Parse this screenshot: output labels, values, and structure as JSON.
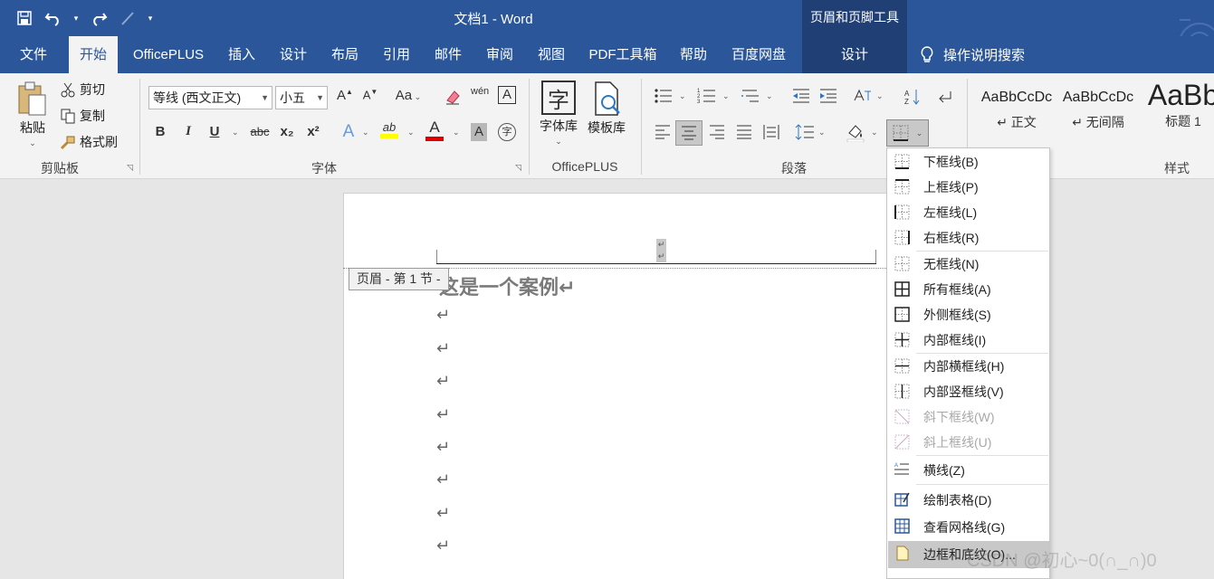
{
  "qat": {
    "save_icon": "save-icon",
    "undo_icon": "undo-icon",
    "redo_icon": "redo-icon",
    "pen_icon": "pen-icon"
  },
  "window": {
    "title": "文档1  -  Word",
    "context_title": "页眉和页脚工具"
  },
  "tabs": [
    {
      "label": "文件"
    },
    {
      "label": "开始"
    },
    {
      "label": "OfficePLUS"
    },
    {
      "label": "插入"
    },
    {
      "label": "设计"
    },
    {
      "label": "布局"
    },
    {
      "label": "引用"
    },
    {
      "label": "邮件"
    },
    {
      "label": "审阅"
    },
    {
      "label": "视图"
    },
    {
      "label": "PDF工具箱"
    },
    {
      "label": "帮助"
    },
    {
      "label": "百度网盘"
    },
    {
      "label": "设计"
    }
  ],
  "tellme": {
    "label": "操作说明搜索"
  },
  "clipboard": {
    "paste": "粘贴",
    "cut": "剪切",
    "copy": "复制",
    "format_painter": "格式刷",
    "label": "剪贴板"
  },
  "font": {
    "name": "等线 (西文正文)",
    "size": "小五",
    "label": "字体",
    "bold": "B",
    "italic": "I",
    "underline": "U",
    "strike": "abc",
    "sub": "x₂",
    "sup": "x²",
    "aa": "Aa",
    "grow": "A",
    "shrink": "A",
    "effects": "A",
    "highlight": "ab",
    "color": "A",
    "shade": "A",
    "enclose": "字",
    "phonetic": "wén",
    "border": "A",
    "highlight_color": "#ffff00",
    "font_color": "#e00000"
  },
  "officeplus": {
    "font_lib": "字体库",
    "template_lib": "模板库",
    "label": "OfficePLUS",
    "font_glyph": "字"
  },
  "paragraph": {
    "label": "段落"
  },
  "styles": {
    "label": "样式",
    "items": [
      {
        "preview": "AaBbCcDc",
        "name": "↵ 正文"
      },
      {
        "preview": "AaBbCcDc",
        "name": "↵ 无间隔"
      },
      {
        "preview": "AaBb",
        "name": "标题 1"
      }
    ]
  },
  "document": {
    "header_tag": "页眉 - 第 1 节 -",
    "title": "这是一个案例↵",
    "para_mark": "↵"
  },
  "border_menu": {
    "items": [
      {
        "label": "下框线(B)",
        "icon": "bottom-border-icon",
        "disabled": false
      },
      {
        "label": "上框线(P)",
        "icon": "top-border-icon",
        "disabled": false
      },
      {
        "label": "左框线(L)",
        "icon": "left-border-icon",
        "disabled": false
      },
      {
        "label": "右框线(R)",
        "icon": "right-border-icon",
        "disabled": false
      },
      {
        "label": "无框线(N)",
        "icon": "no-border-icon",
        "disabled": false
      },
      {
        "label": "所有框线(A)",
        "icon": "all-borders-icon",
        "disabled": false
      },
      {
        "label": "外侧框线(S)",
        "icon": "outside-borders-icon",
        "disabled": false
      },
      {
        "label": "内部框线(I)",
        "icon": "inside-borders-icon",
        "disabled": false
      },
      {
        "label": "内部横框线(H)",
        "icon": "inside-horizontal-border-icon",
        "disabled": false
      },
      {
        "label": "内部竖框线(V)",
        "icon": "inside-vertical-border-icon",
        "disabled": false
      },
      {
        "label": "斜下框线(W)",
        "icon": "diagonal-down-border-icon",
        "disabled": true
      },
      {
        "label": "斜上框线(U)",
        "icon": "diagonal-up-border-icon",
        "disabled": true
      },
      {
        "label": "横线(Z)",
        "icon": "horizontal-line-icon",
        "disabled": false
      },
      {
        "label": "绘制表格(D)",
        "icon": "draw-table-icon",
        "disabled": false
      },
      {
        "label": "查看网格线(G)",
        "icon": "view-gridlines-icon",
        "disabled": false
      },
      {
        "label": "边框和底纹(O)...",
        "icon": "borders-shading-icon",
        "disabled": false
      }
    ]
  },
  "watermark": "CSDN @初心~0(∩_∩)0"
}
